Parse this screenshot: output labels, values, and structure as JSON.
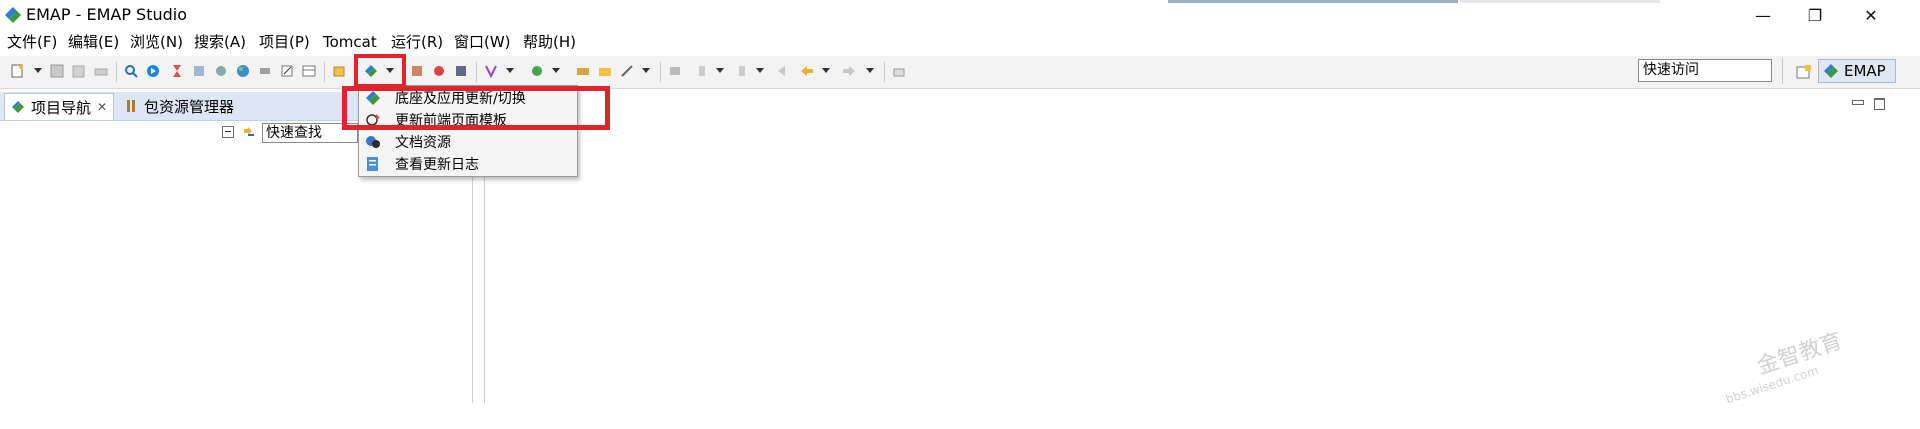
{
  "window": {
    "title": "EMAP - EMAP Studio"
  },
  "colors": {
    "accent_green": "#3a9a3a",
    "highlight_red": "#e0242b",
    "tab_strip": "#dce6f4",
    "toolbar_bg": "#f3f3f3"
  },
  "menubar": {
    "items": [
      {
        "label": "文件(F)"
      },
      {
        "label": "编辑(E)"
      },
      {
        "label": "浏览(N)"
      },
      {
        "label": "搜索(A)"
      },
      {
        "label": "项目(P)"
      },
      {
        "label": "Tomcat"
      },
      {
        "label": "运行(R)"
      },
      {
        "label": "窗口(W)"
      },
      {
        "label": "帮助(H)"
      }
    ]
  },
  "toolbar": {
    "quick_access_value": "快速访问",
    "perspective_label": "EMAP"
  },
  "left_view": {
    "tabs": [
      {
        "label": "项目导航"
      },
      {
        "label": "包资源管理器"
      }
    ],
    "quick_find_value": "快速查找"
  },
  "dropdown": {
    "items": [
      {
        "label": "底座及应用更新/切换",
        "icon": "emap-update-icon"
      },
      {
        "label": "更新前端页面模板",
        "icon": "refresh-template-icon"
      },
      {
        "label": "文档资源",
        "icon": "document-resource-icon"
      },
      {
        "label": "查看更新日志",
        "icon": "update-log-icon"
      }
    ]
  },
  "watermark": {
    "text_line1": "金智教育",
    "text_line2": "bbs.wisedu.com"
  }
}
